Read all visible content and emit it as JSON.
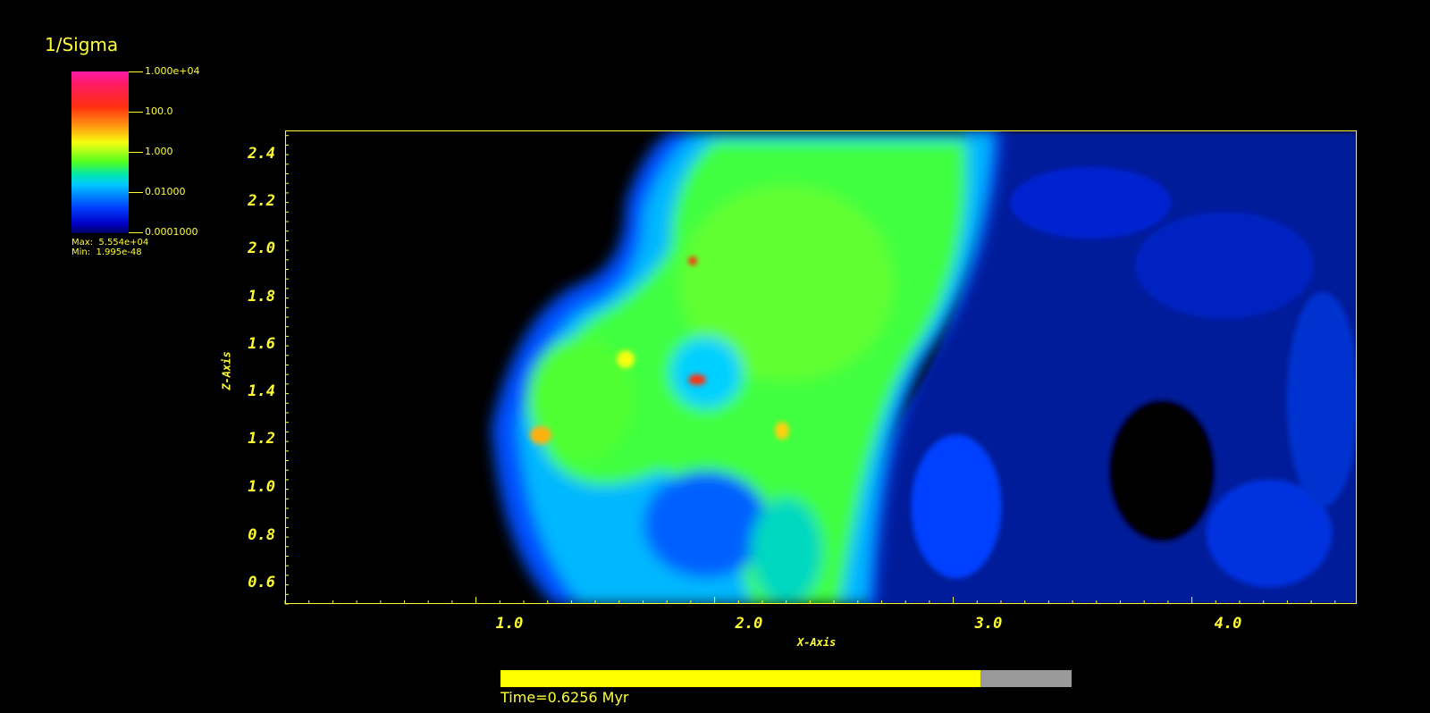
{
  "legend": {
    "title": "1/Sigma",
    "ticks": [
      "1.000e+04",
      "100.0",
      "1.000",
      "0.01000",
      "0.0001000"
    ],
    "max": "Max:  5.554e+04",
    "min": "Min:  1.995e-48"
  },
  "plot": {
    "x_axis": {
      "label": "X-Axis",
      "ticks": [
        "1.0",
        "2.0",
        "3.0",
        "4.0"
      ],
      "range": [
        0.05,
        4.55
      ]
    },
    "y_axis": {
      "label": "Z-Axis",
      "ticks": [
        "2.4",
        "2.2",
        "2.0",
        "1.8",
        "1.6",
        "1.4",
        "1.2",
        "1.0",
        "0.8",
        "0.6"
      ],
      "range": [
        0.52,
        2.5
      ]
    },
    "colors": {
      "frame": "#ffff33",
      "background": "#000000",
      "low": "#0000c8",
      "mid": "#00e6b0",
      "high": "#50ff20",
      "peak": "#ff3010"
    }
  },
  "progress": {
    "fraction": 0.84,
    "fill_color": "#ffff00",
    "track_color": "#9a9a9a"
  },
  "time_label": "Time=0.6256 Myr"
}
